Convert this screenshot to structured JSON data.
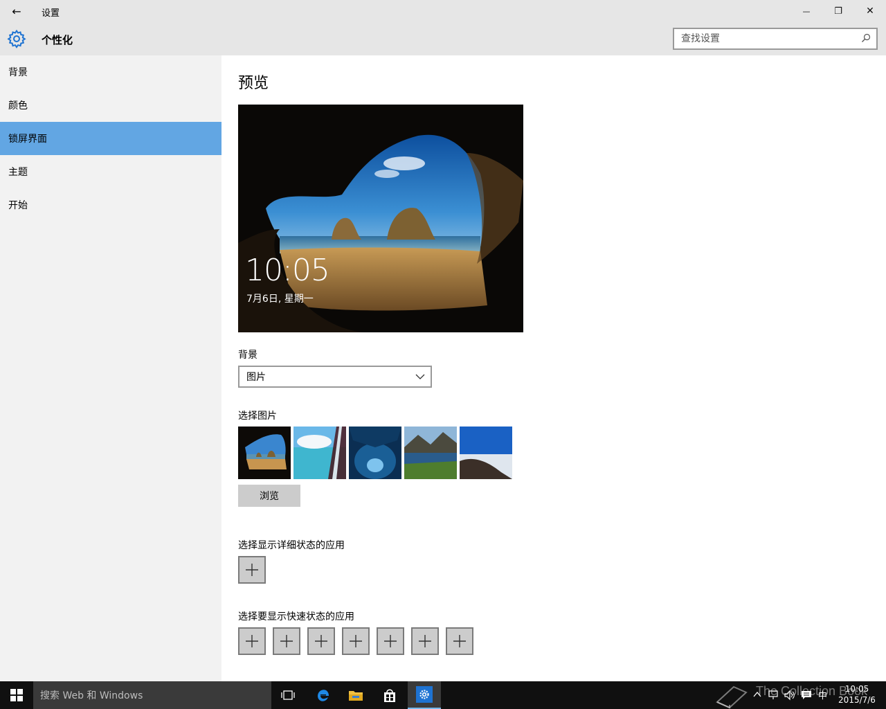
{
  "window": {
    "title": "设置",
    "minimize_glyph": "—",
    "restore_glyph": "❐",
    "close_glyph": "✕",
    "back_glyph": "←"
  },
  "header": {
    "section": "个性化",
    "icon": "gear-icon",
    "search_placeholder": "查找设置"
  },
  "sidebar": {
    "items": [
      {
        "label": "背景",
        "active": false
      },
      {
        "label": "颜色",
        "active": false
      },
      {
        "label": "锁屏界面",
        "active": true
      },
      {
        "label": "主题",
        "active": false
      },
      {
        "label": "开始",
        "active": false
      }
    ],
    "active_color": "#62a6e3"
  },
  "main": {
    "preview_title": "预览",
    "preview_time": "10:05",
    "preview_date": "7月6日, 星期一",
    "background_label": "背景",
    "background_value": "图片",
    "choose_picture_label": "选择图片",
    "browse_label": "浏览",
    "detailed_status_label": "选择显示详细状态的应用",
    "quick_status_label": "选择要显示快速状态的应用"
  },
  "taskbar": {
    "search_text": "搜索 Web 和 Windows",
    "ime": "中",
    "clock_time": "10:05",
    "clock_date": "2015/7/6",
    "watermark": "The Collection Book",
    "accent_color": "#76b9ed"
  }
}
